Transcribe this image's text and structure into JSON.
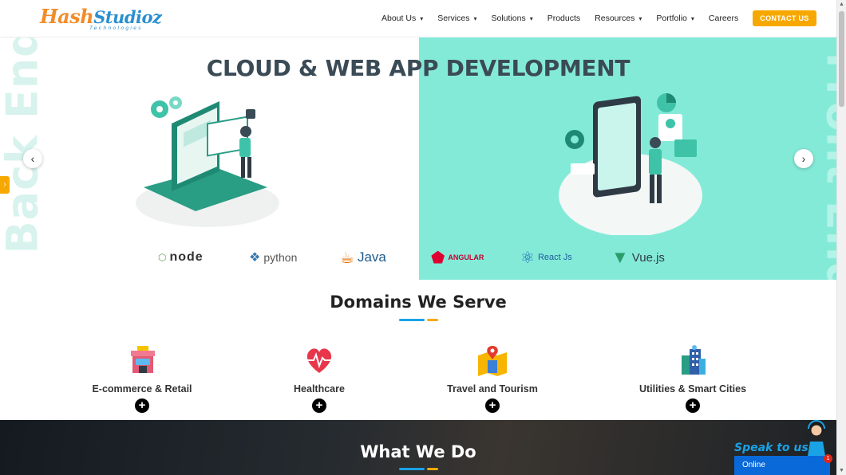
{
  "header": {
    "logo": {
      "hash": "Hash",
      "studioz": "Studioz",
      "sub": "Technologies"
    },
    "nav": [
      {
        "label": "About Us",
        "dropdown": true
      },
      {
        "label": "Services",
        "dropdown": true
      },
      {
        "label": "Solutions",
        "dropdown": true
      },
      {
        "label": "Products",
        "dropdown": false
      },
      {
        "label": "Resources",
        "dropdown": true
      },
      {
        "label": "Portfolio",
        "dropdown": true
      },
      {
        "label": "Careers",
        "dropdown": false
      }
    ],
    "contact_label": "CONTACT US",
    "caret": "⌄"
  },
  "hero": {
    "title": "CLOUD & WEB APP DEVELOPMENT",
    "left_word": "Back End",
    "right_word": "Front End",
    "prev_icon": "‹",
    "next_icon": "›",
    "tab_icon": "›",
    "backend_tech": [
      {
        "name": "node",
        "icon": "nodejs-icon"
      },
      {
        "name": "python",
        "icon": "python-icon"
      },
      {
        "name": "Java",
        "icon": "java-icon"
      }
    ],
    "frontend_tech": [
      {
        "name": "ANGULAR",
        "icon": "angular-icon"
      },
      {
        "name": "React Js",
        "icon": "react-icon"
      },
      {
        "name": "Vue.js",
        "icon": "vue-icon"
      }
    ]
  },
  "domains": {
    "title": "Domains We Serve",
    "items": [
      {
        "label": "E-commerce & Retail",
        "icon": "store-icon"
      },
      {
        "label": "Healthcare",
        "icon": "heart-pulse-icon"
      },
      {
        "label": "Travel and Tourism",
        "icon": "map-pin-icon"
      },
      {
        "label": "Utilities & Smart Cities",
        "icon": "city-icon"
      }
    ],
    "plus": "+"
  },
  "what_we_do": {
    "title": "What We Do"
  },
  "chat": {
    "speak": "Speak to us!",
    "status": "Online",
    "badge": "1"
  },
  "colors": {
    "accent_orange": "#f7a800",
    "accent_blue": "#1aa2e6",
    "hero_mint": "#84ead8",
    "title_dark": "#3b4b56"
  }
}
